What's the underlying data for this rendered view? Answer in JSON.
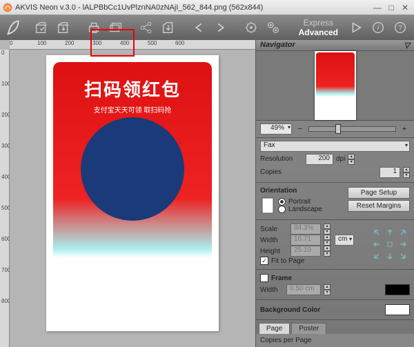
{
  "window": {
    "title": "AKVIS Neon v.3.0 - lALPBbCc1UvPlznNA0zNAjI_562_844.png (562x844)"
  },
  "modes": {
    "express": "Express",
    "advanced": "Advanced",
    "active": "advanced"
  },
  "rulerH": [
    "0",
    "100",
    "200",
    "300",
    "400",
    "500",
    "600"
  ],
  "rulerV": [
    "0",
    "100",
    "200",
    "300",
    "400",
    "500",
    "600",
    "700",
    "800"
  ],
  "image": {
    "title": "扫码领红包",
    "subtitle": "支付宝天天可领 取扫码抢"
  },
  "navigator": {
    "label": "Navigator",
    "zoom": "49%"
  },
  "printer": {
    "label": "Fax"
  },
  "resolution": {
    "label": "Resolution",
    "value": "200",
    "unit": "dpi"
  },
  "copies": {
    "label": "Copies",
    "value": "1"
  },
  "orientation": {
    "label": "Orientation",
    "portrait": "Portrait",
    "landscape": "Landscape",
    "selected": "portrait"
  },
  "buttons": {
    "pageSetup": "Page Setup",
    "resetMargins": "Reset Margins"
  },
  "scale": {
    "label": "Scale",
    "value": "84.3%"
  },
  "width": {
    "label": "Width",
    "value": "16.71"
  },
  "height": {
    "label": "Height",
    "value": "25.10"
  },
  "unit": "cm",
  "fitToPage": {
    "label": "Fit to Page",
    "checked": true
  },
  "frame": {
    "label": "Frame",
    "checked": false,
    "widthLabel": "Width",
    "widthValue": "0.50 cm",
    "color": "#000000"
  },
  "bgcolor": {
    "label": "Background Color",
    "value": "#ffffff"
  },
  "tabs": {
    "page": "Page",
    "poster": "Poster"
  },
  "copiesPerPage": "Copies per Page"
}
